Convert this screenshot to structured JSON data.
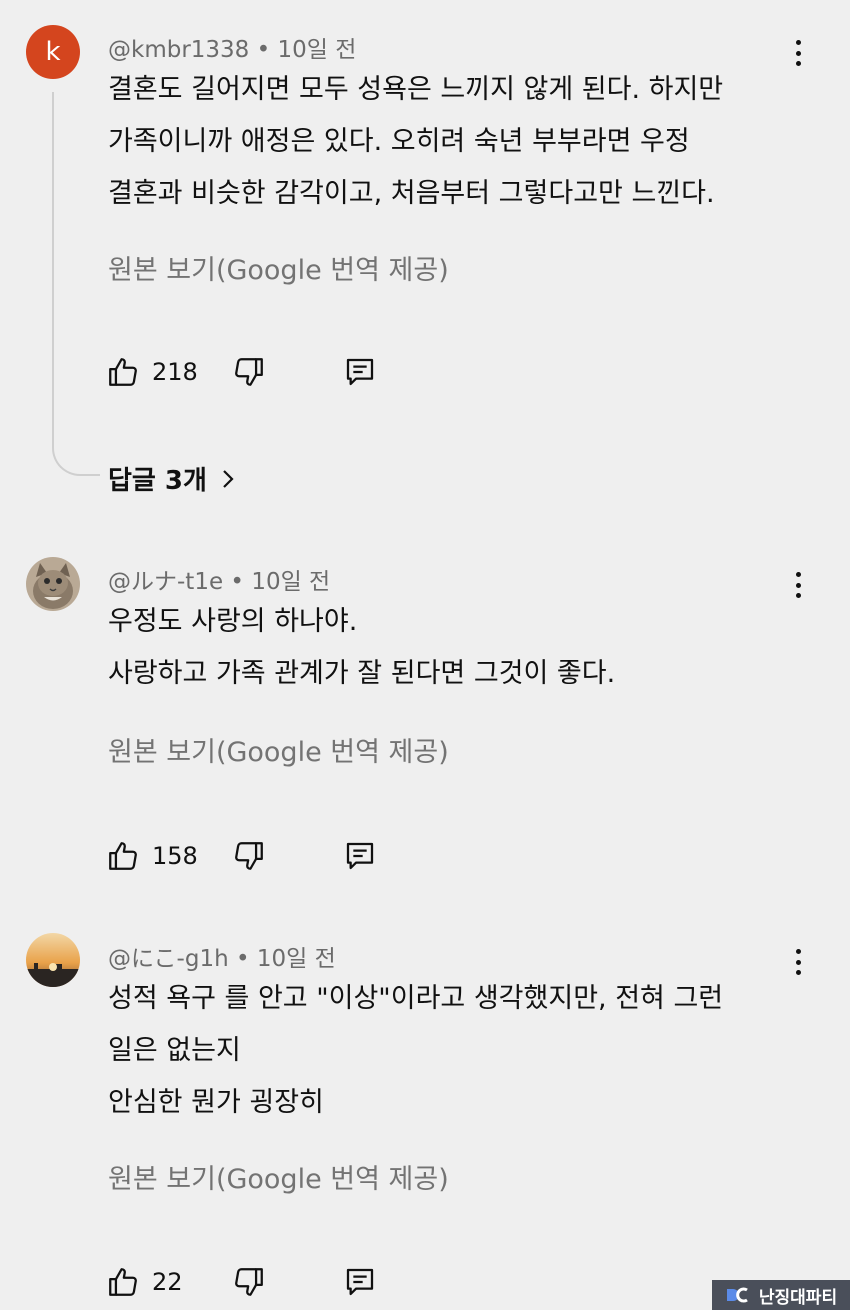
{
  "comments": [
    {
      "avatar_letter": "k",
      "avatar_color": "#d4451e",
      "handle": "@kmbr1338",
      "time": "10일 전",
      "lines": [
        "결혼도 길어지면 모두 성욕은 느끼지 않게 된다. 하지만",
        "가족이니까 애정은 있다. 오히려 숙년 부부라면 우정",
        "결혼과 비슷한 감각이고, 처음부터 그렇다고만 느낀다."
      ],
      "translate_label": "원본 보기(Google 번역 제공)",
      "likes": "218",
      "replies_label": "답글 3개"
    },
    {
      "avatar_icon": "cat-avatar",
      "handle": "@ルナ-t1e",
      "time": "10일 전",
      "lines": [
        "우정도 사랑의 하나야.",
        "사랑하고 가족 관계가 잘 된다면 그것이 좋다."
      ],
      "translate_label": "원본 보기(Google 번역 제공)",
      "likes": "158"
    },
    {
      "avatar_icon": "sunset-avatar",
      "handle": "@にこ-g1h",
      "time": "10일 전",
      "lines": [
        "성적 욕구 를 안고 \"이상\"이라고 생각했지만, 전혀 그런",
        "일은 없는지",
        "안심한 뭔가 굉장히"
      ],
      "translate_label": "원본 보기(Google 번역 제공)",
      "likes": "22"
    }
  ],
  "watermark": {
    "logo": "dc-logo",
    "text": "난징대파티"
  }
}
